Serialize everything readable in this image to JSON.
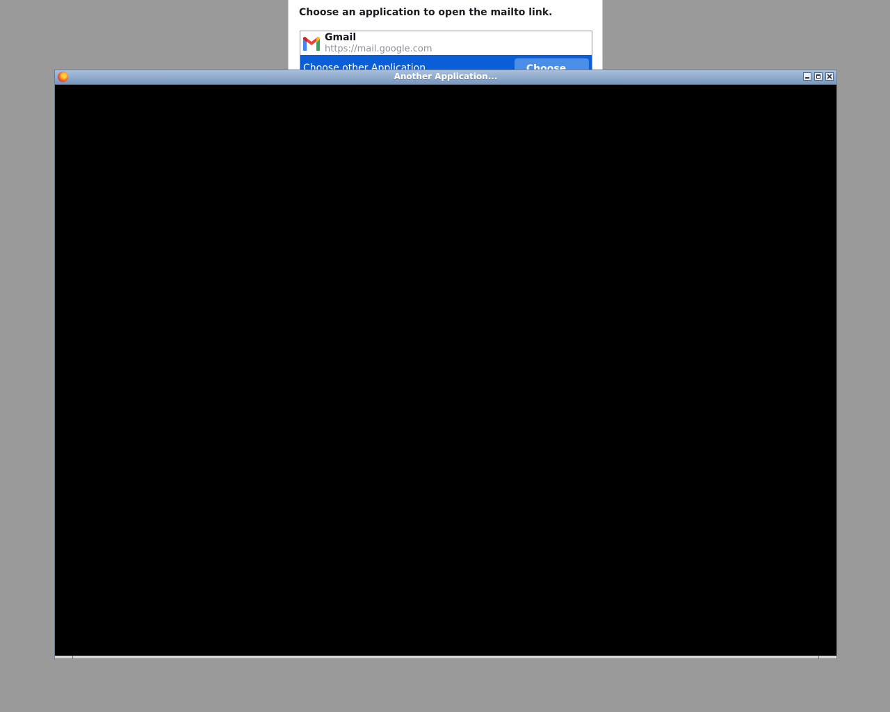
{
  "dialog": {
    "title": "Choose an application to open the mailto link.",
    "apps": [
      {
        "name": "Gmail",
        "url": "https://mail.google.com",
        "icon": "gmail-icon"
      }
    ],
    "other_label": "Choose other Application",
    "choose_button": "Choose...",
    "accent_color": "#0a5fd9"
  },
  "window": {
    "title": "Another Application...",
    "icon": "firefox-icon",
    "controls": [
      "minimize",
      "maximize",
      "close"
    ]
  }
}
